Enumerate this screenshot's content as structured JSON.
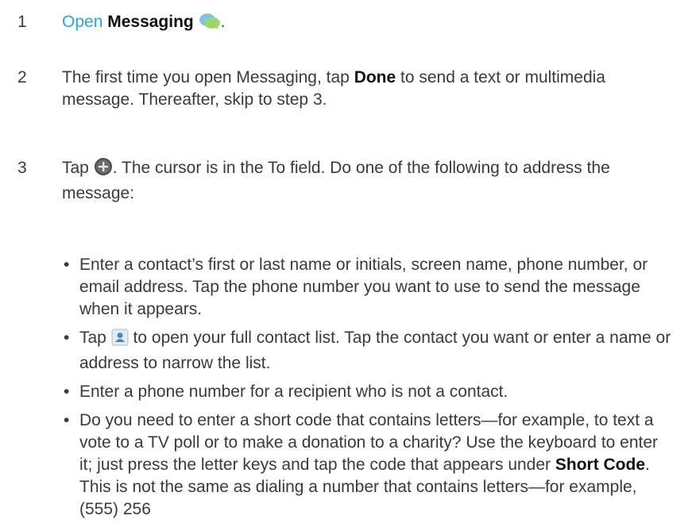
{
  "steps": [
    {
      "number": "1",
      "open_word": "Open",
      "app_name": "Messaging",
      "end": "."
    },
    {
      "number": "2",
      "before": "The first time you open Messaging, tap ",
      "bold": "Done",
      "after": " to send a text or multimedia message. Thereafter, skip to step 3."
    },
    {
      "number": "3",
      "before": "Tap ",
      "after": ". The cursor is in the To field. Do one of the following to address the message:"
    }
  ],
  "bullets": {
    "b1": "Enter a contact’s first or last name or initials, screen name, phone number, or email address. Tap the phone number you want to use to send the message when it appears.",
    "b2_before": "Tap ",
    "b2_after": " to open your full contact list. Tap the contact you want or enter a name or address to narrow the list.",
    "b3": "Enter a phone number for a recipient who is not a contact.",
    "b4_before": "Do you need to enter a short code that contains letters—for example, to text a vote to a TV poll or to make a donation to a charity? Use the keyboard to enter it; just press the letter keys and tap the code that appears under ",
    "b4_bold": "Short Code",
    "b4_after": ". This is not the same as dialing a number that contains letters—for example, (555) 256"
  },
  "bullet_char": "•",
  "icons": [
    "messaging-icon",
    "new-message-icon",
    "contacts-icon"
  ],
  "colors": {
    "link": "#2aa5d6",
    "text": "#3a3a3a",
    "bold": "#111111"
  }
}
